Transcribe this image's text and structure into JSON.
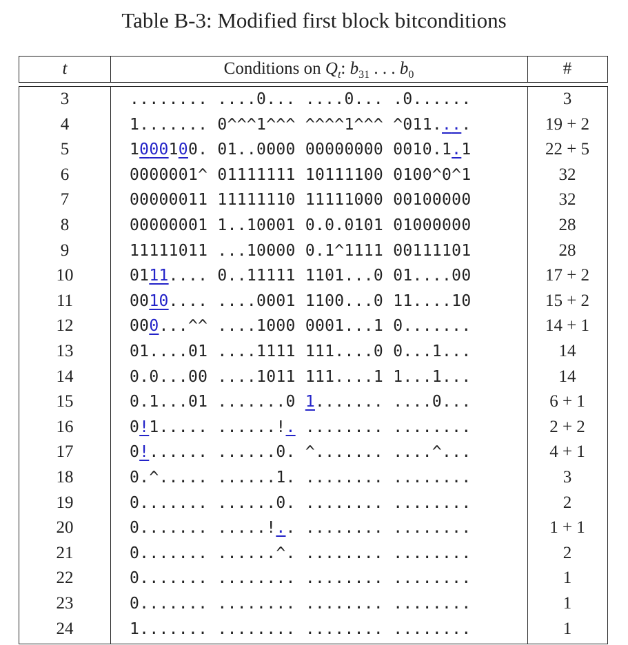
{
  "caption": "Table B-3: Modified first block bitconditions",
  "header": {
    "t": "t",
    "conditions_prefix": "Conditions on ",
    "q_var": "Q",
    "q_sub": "t",
    "colon": ": ",
    "b_high": "b",
    "b_high_sub": "31",
    "dots": " . . . ",
    "b_low": "b",
    "b_low_sub": "0",
    "count": "#"
  },
  "rows": [
    {
      "t": "3",
      "conditions": "........ ....0... ....0... .0......",
      "count": "3",
      "highlight": []
    },
    {
      "t": "4",
      "conditions": "1....... 0^^^1^^^ ^^^^1^^^ ^011....",
      "count": "19 + 2",
      "highlight": [
        29,
        30
      ]
    },
    {
      "t": "5",
      "conditions": "1000100. 01..0000 00000000 0010.1.1",
      "count": "22 + 5",
      "highlight": [
        1,
        2,
        3,
        5,
        30
      ]
    },
    {
      "t": "6",
      "conditions": "0000001^ 01111111 10111100 0100^0^1",
      "count": "32",
      "highlight": []
    },
    {
      "t": "7",
      "conditions": "00000011 11111110 11111000 00100000",
      "count": "32",
      "highlight": []
    },
    {
      "t": "8",
      "conditions": "00000001 1..10001 0.0.0101 01000000",
      "count": "28",
      "highlight": []
    },
    {
      "t": "9",
      "conditions": "11111011 ...10000 0.1^1111 00111101",
      "count": "28",
      "highlight": []
    },
    {
      "t": "10",
      "conditions": "0111.... 0..11111 1101...0 01....00",
      "count": "17 + 2",
      "highlight": [
        2,
        3
      ]
    },
    {
      "t": "11",
      "conditions": "0010.... ....0001 1100...0 11....10",
      "count": "15 + 2",
      "highlight": [
        2,
        3
      ]
    },
    {
      "t": "12",
      "conditions": "000...^^ ....1000 0001...1 0.......",
      "count": "14 + 1",
      "highlight": [
        2
      ]
    },
    {
      "t": "13",
      "conditions": "01....01 ....1111 111....0 0...1...",
      "count": "14",
      "highlight": []
    },
    {
      "t": "14",
      "conditions": "0.0...00 ....1011 111....1 1...1...",
      "count": "14",
      "highlight": []
    },
    {
      "t": "15",
      "conditions": "0.1...01 .......0 1....... ....0...",
      "count": "6 + 1",
      "highlight": [
        16
      ]
    },
    {
      "t": "16",
      "conditions": "0!1..... ......!. ........ ........",
      "count": "2 + 2",
      "highlight": [
        1,
        15
      ]
    },
    {
      "t": "17",
      "conditions": "0!...... ......0. ^....... ....^...",
      "count": "4 + 1",
      "highlight": [
        1
      ]
    },
    {
      "t": "18",
      "conditions": "0.^..... ......1. ........ ........",
      "count": "3",
      "highlight": []
    },
    {
      "t": "19",
      "conditions": "0....... ......0. ........ ........",
      "count": "2",
      "highlight": []
    },
    {
      "t": "20",
      "conditions": "0....... .....!.. ........ ........",
      "count": "1 + 1",
      "highlight": [
        14
      ]
    },
    {
      "t": "21",
      "conditions": "0....... ......^. ........ ........",
      "count": "2",
      "highlight": []
    },
    {
      "t": "22",
      "conditions": "0....... ........ ........ ........",
      "count": "1",
      "highlight": []
    },
    {
      "t": "23",
      "conditions": "0....... ........ ........ ........",
      "count": "1",
      "highlight": []
    },
    {
      "t": "24",
      "conditions": "1....... ........ ........ ........",
      "count": "1",
      "highlight": []
    }
  ]
}
